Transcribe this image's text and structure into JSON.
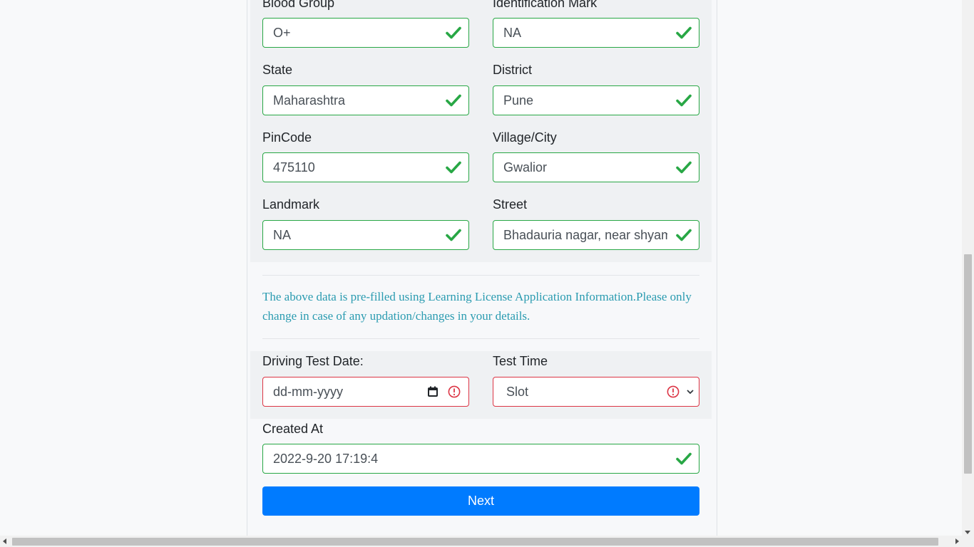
{
  "form": {
    "fields": [
      {
        "label": "Blood Group",
        "value": "O+"
      },
      {
        "label": "Identification Mark",
        "value": "NA"
      },
      {
        "label": "State",
        "value": "Maharashtra"
      },
      {
        "label": "District",
        "value": "Pune"
      },
      {
        "label": "PinCode",
        "value": "475110"
      },
      {
        "label": "Village/City",
        "value": "Gwalior"
      },
      {
        "label": "Landmark",
        "value": "NA"
      },
      {
        "label": "Street",
        "value": "Bhadauria nagar, near shyam b"
      }
    ],
    "note": "The above data is pre-filled using Learning License Application Information.Please only change in case of any updation/changes in your details.",
    "driving_test_date": {
      "label": "Driving Test Date:",
      "placeholder": "dd-mm-yyyy"
    },
    "test_time": {
      "label": "Test Time",
      "selected": "Slot"
    },
    "created_at": {
      "label": "Created At",
      "value": "2022-9-20 17:19:4"
    },
    "next_label": "Next"
  },
  "colors": {
    "valid": "#28a745",
    "invalid": "#dc3545",
    "primary": "#007bff",
    "note": "#2a9bb0"
  }
}
